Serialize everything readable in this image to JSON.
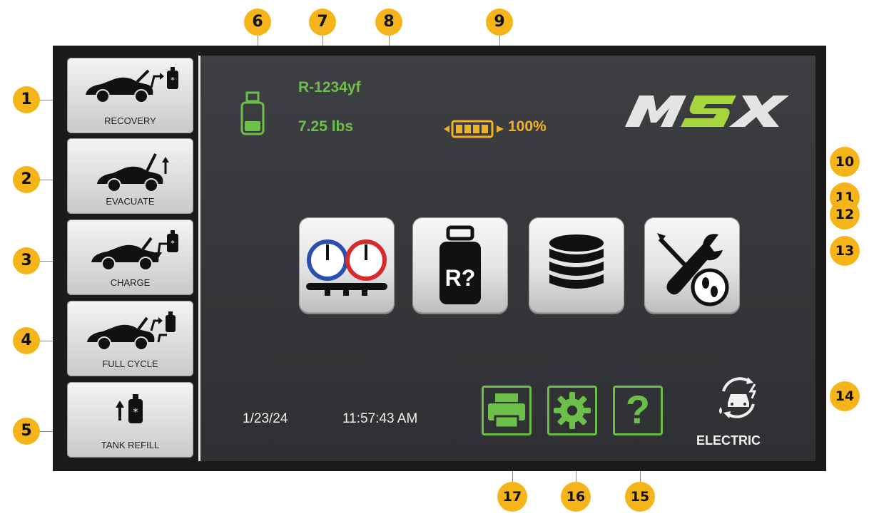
{
  "sidebar": {
    "items": [
      {
        "label": "RECOVERY"
      },
      {
        "label": "EVACUATE"
      },
      {
        "label": "CHARGE"
      },
      {
        "label": "FULL CYCLE"
      },
      {
        "label": "TANK REFILL"
      }
    ]
  },
  "status": {
    "refrigerant": "R-1234yf",
    "tank_weight": "7.25 lbs",
    "battery_percent": "100%",
    "date": "1/23/24",
    "time": "11:57:43 AM",
    "power_mode": "ELECTRIC"
  },
  "brand": {
    "logo_text": "MSX"
  },
  "tiles": [
    {
      "icon": "manifold-gauges-icon"
    },
    {
      "icon": "refrigerant-identifier-icon",
      "text": "R?"
    },
    {
      "icon": "database-icon"
    },
    {
      "icon": "service-tools-icon"
    }
  ],
  "bottom_buttons": [
    {
      "icon": "printer-icon"
    },
    {
      "icon": "gear-icon"
    },
    {
      "icon": "help-icon",
      "text": "?"
    }
  ],
  "callouts": [
    "1",
    "2",
    "3",
    "4",
    "5",
    "6",
    "7",
    "8",
    "9",
    "10",
    "11",
    "12",
    "13",
    "14",
    "15",
    "16",
    "17"
  ],
  "colors": {
    "accent_green": "#6cc04a",
    "badge_yellow": "#f5b51a",
    "battery_yellow": "#f2b025",
    "screen_bg": "#3a3c3f"
  }
}
